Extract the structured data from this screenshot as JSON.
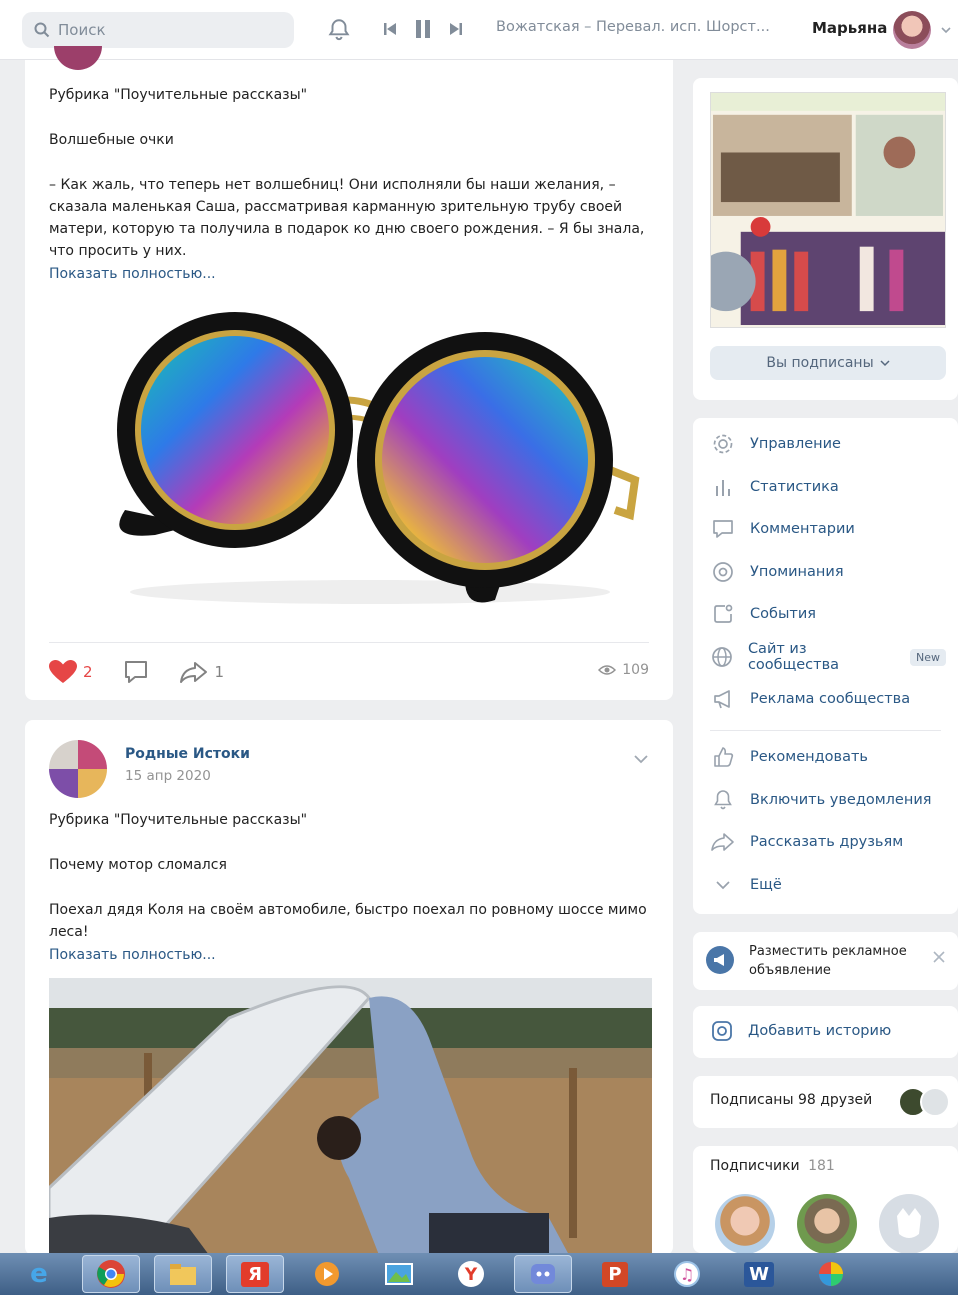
{
  "topbar": {
    "search_placeholder": "Поиск",
    "track_title": "Вожатская – Перевал. исп. Шорст...",
    "user_name": "Марьяна"
  },
  "post1": {
    "rubric": "Рубрика \"Поучительные рассказы\"",
    "title": "Волшебные очки",
    "body_lines": [
      "– Как жаль, что теперь нет волшебниц! Они исполняли бы наши желания, –",
      "сказала маленькая Саша, рассматривая карманную зрительную трубу своей",
      "матери, которую та получила в подарок ко дню своего рождения. – Я бы знала,",
      "что просить у них."
    ],
    "show_more": "Показать полностью...",
    "likes": "2",
    "shares": "1",
    "views": "109"
  },
  "post2": {
    "author": "Родные Истоки",
    "date": "15 апр 2020",
    "rubric": "Рубрика \"Поучительные рассказы\"",
    "title": "Почему мотор сломался",
    "body_lines": [
      "Поехал дядя Коля на своём автомобиле, быстро поехал по ровному шоссе мимо",
      "леса!"
    ],
    "show_more": "Показать полностью..."
  },
  "sidebar": {
    "subscribed_btn": "Вы подписаны",
    "menu": [
      {
        "label": "Управление",
        "icon": "gear-icon"
      },
      {
        "label": "Статистика",
        "icon": "stats-icon"
      },
      {
        "label": "Комментарии",
        "icon": "comment-icon"
      },
      {
        "label": "Упоминания",
        "icon": "mention-icon"
      },
      {
        "label": "События",
        "icon": "events-icon"
      },
      {
        "label": "Сайт из сообщества",
        "icon": "globe-icon",
        "badge": "New"
      },
      {
        "label": "Реклама сообщества",
        "icon": "megaphone-icon"
      }
    ],
    "menu2": [
      {
        "label": "Рекомендовать",
        "icon": "thumb-up-icon"
      },
      {
        "label": "Включить уведомления",
        "icon": "bell-icon"
      },
      {
        "label": "Рассказать друзьям",
        "icon": "share-icon"
      },
      {
        "label": "Ещё",
        "icon": "chevron-down-icon"
      }
    ],
    "ad_line1": "Разместить рекламное",
    "ad_line2": "объявление",
    "add_story": "Добавить историю",
    "friends_subscribed": "Подписаны 98 друзей",
    "subscribers_label": "Подписчики",
    "subscribers_count": "181"
  },
  "taskbar": {
    "apps": [
      "ie-icon",
      "chrome-icon",
      "explorer-icon",
      "yandex-icon",
      "media-player-icon",
      "photo-viewer-icon",
      "yandex-browser-icon",
      "discord-icon",
      "powerpoint-icon",
      "itunes-icon",
      "word-icon",
      "picasa-icon"
    ]
  },
  "colors": {
    "link": "#2a5885",
    "like": "#e64646",
    "background": "#edeef0",
    "accent": "#4a76a8"
  }
}
